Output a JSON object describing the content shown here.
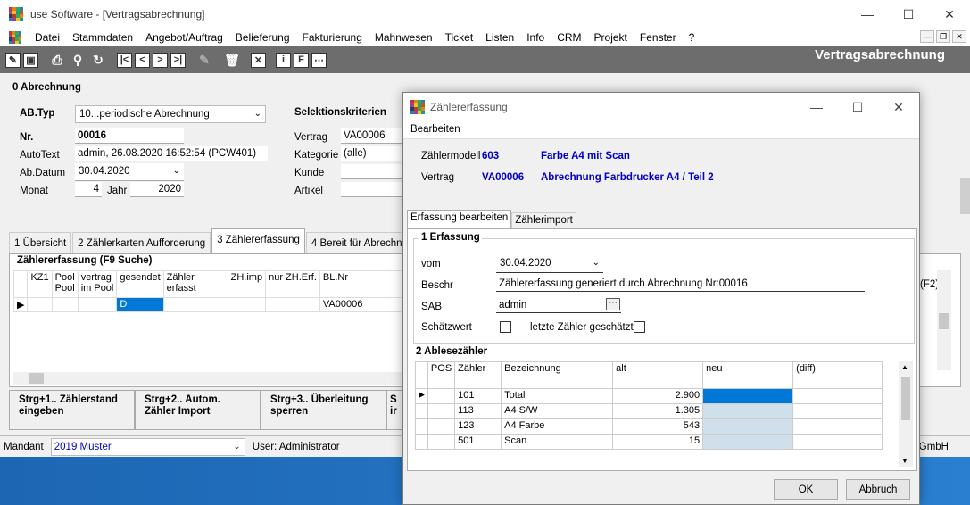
{
  "window": {
    "title": "use Software - [Vertragsabrechnung]"
  },
  "menu": {
    "items": [
      "Datei",
      "Stammdaten",
      "Angebot/Auftrag",
      "Belieferung",
      "Fakturierung",
      "Mahnwesen",
      "Ticket",
      "Listen",
      "Info",
      "CRM",
      "Projekt",
      "Fenster",
      "?"
    ]
  },
  "toolbar": {
    "heading": "Vertragsabrechnung"
  },
  "abrechnung": {
    "section_label": "0 Abrechnung",
    "abtyp_label": "AB.Typ",
    "abtyp_value": "10...periodische Abrechnung",
    "nr_label": "Nr.",
    "nr_value": "00016",
    "autotext_label": "AutoText",
    "autotext_value": "admin, 26.08.2020 16:52:54 (PCW401)",
    "abdatum_label": "Ab.Datum",
    "abdatum_value": "30.04.2020",
    "monat_label": "Monat",
    "monat_value": "4",
    "jahr_label": "Jahr",
    "jahr_value": "2020"
  },
  "selektion": {
    "title": "Selektionskriterien",
    "vertrag_label": "Vertrag",
    "vertrag_value": "VA00006",
    "kategorie_label": "Kategorie",
    "kategorie_value": "(alle)",
    "kunde_label": "Kunde",
    "artikel_label": "Artikel"
  },
  "tabs": [
    "1 Übersicht",
    "2 Zählerkarten Aufforderung",
    "3 Zählererfassung",
    "4 Bereit für Abrechnung"
  ],
  "grid": {
    "title": "Zählererfassung (F9 Suche)",
    "columns": [
      "KZ1",
      "Pool",
      "vertrag im Pool",
      "gesendet",
      "Zähler erfasst",
      "ZH.imp",
      "nur ZH.Erf.",
      "BL.Nr"
    ],
    "col_pool_line1": "Pool",
    "col_pool_line2": "Pool",
    "col_vim_line1": "vertrag",
    "col_vim_line2": "im Pool",
    "row": {
      "gesendet": "D",
      "blnr": "VA00006"
    },
    "right_hint": "(F2)"
  },
  "buttons": {
    "b1_line1": "Strg+1.. Zählerstand",
    "b1_line2": "eingeben",
    "b2_line1": "Strg+2.. Autom.",
    "b2_line2": "Zähler Import",
    "b3_line1": "Strg+3.. Überleitung",
    "b3_line2": "sperren",
    "b4_line1": "S",
    "b4_line2": "ir"
  },
  "status": {
    "mandant_label": "Mandant",
    "mandant_value": "2019 Muster",
    "user": "User: Administrator",
    "right": "GmbH"
  },
  "dialog": {
    "title": "Zählererfassung",
    "menu": "Bearbeiten",
    "zaehlermodell_label": "Zählermodell",
    "zaehlermodell_nr": "603",
    "zaehlermodell_name": "Farbe A4 mit Scan",
    "vertrag_label": "Vertrag",
    "vertrag_nr": "VA00006",
    "vertrag_name": "Abrechnung Farbdrucker A4 / Teil 2",
    "tabs": [
      "Erfassung bearbeiten",
      "Zählerimport"
    ],
    "erfassung": {
      "label": "1 Erfassung",
      "vom_label": "vom",
      "vom_value": "30.04.2020",
      "beschr_label": "Beschr",
      "beschr_value": "Zählererfassung generiert durch Abrechnung Nr:00016",
      "sab_label": "SAB",
      "sab_value": "admin",
      "schaetzwert_label": "Schätzwert",
      "letzte_label": "letzte Zähler geschätzt"
    },
    "ablese": {
      "label": "2 Ablesezähler",
      "columns": [
        "POS",
        "Zähler",
        "Bezeichnung",
        "alt",
        "neu",
        "(diff)"
      ],
      "rows": [
        {
          "zaehler": "101",
          "bez": "Total",
          "alt": "2.900"
        },
        {
          "zaehler": "113",
          "bez": "A4 S/W",
          "alt": "1.305"
        },
        {
          "zaehler": "123",
          "bez": "A4 Farbe",
          "alt": "543"
        },
        {
          "zaehler": "501",
          "bez": "Scan",
          "alt": "15"
        }
      ]
    },
    "ok": "OK",
    "abbruch": "Abbruch"
  },
  "colors": {
    "toolbar": "#6d6d6d",
    "selected_cell": "#0078d7",
    "input_cell": "#cfe0ea",
    "blue_text": "#0000c8"
  }
}
